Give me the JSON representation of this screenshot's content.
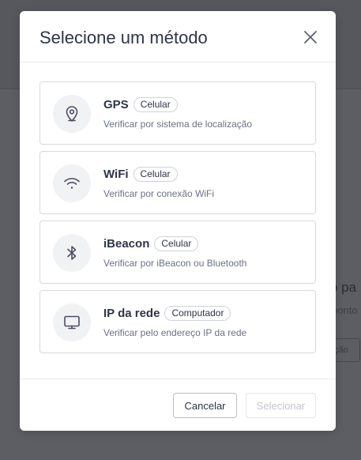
{
  "background": {
    "heading_fragment": "o pa",
    "sub_fragment": "ponto",
    "button_fragment": "ção"
  },
  "modal": {
    "title": "Selecione um método",
    "close_icon": "close-icon",
    "options": [
      {
        "icon": "location-pin-icon",
        "title": "GPS",
        "badge": "Celular",
        "description": "Verificar por sistema de localização"
      },
      {
        "icon": "wifi-icon",
        "title": "WiFi",
        "badge": "Celular",
        "description": "Verificar por conexão WiFi"
      },
      {
        "icon": "bluetooth-icon",
        "title": "iBeacon",
        "badge": "Celular",
        "description": "Verificar por iBeacon ou Bluetooth"
      },
      {
        "icon": "monitor-icon",
        "title": "IP da rede",
        "badge": "Computador",
        "description": "Verificar pelo endereço IP da rede"
      }
    ],
    "footer": {
      "cancel_label": "Cancelar",
      "select_label": "Selecionar"
    }
  },
  "colors": {
    "overlay": "#5d5e64",
    "text": "#2f3447",
    "muted": "#6b7183",
    "border": "#d7d9df",
    "icon_bg": "#f1f2f4",
    "disabled_text": "#c3c6ce"
  }
}
